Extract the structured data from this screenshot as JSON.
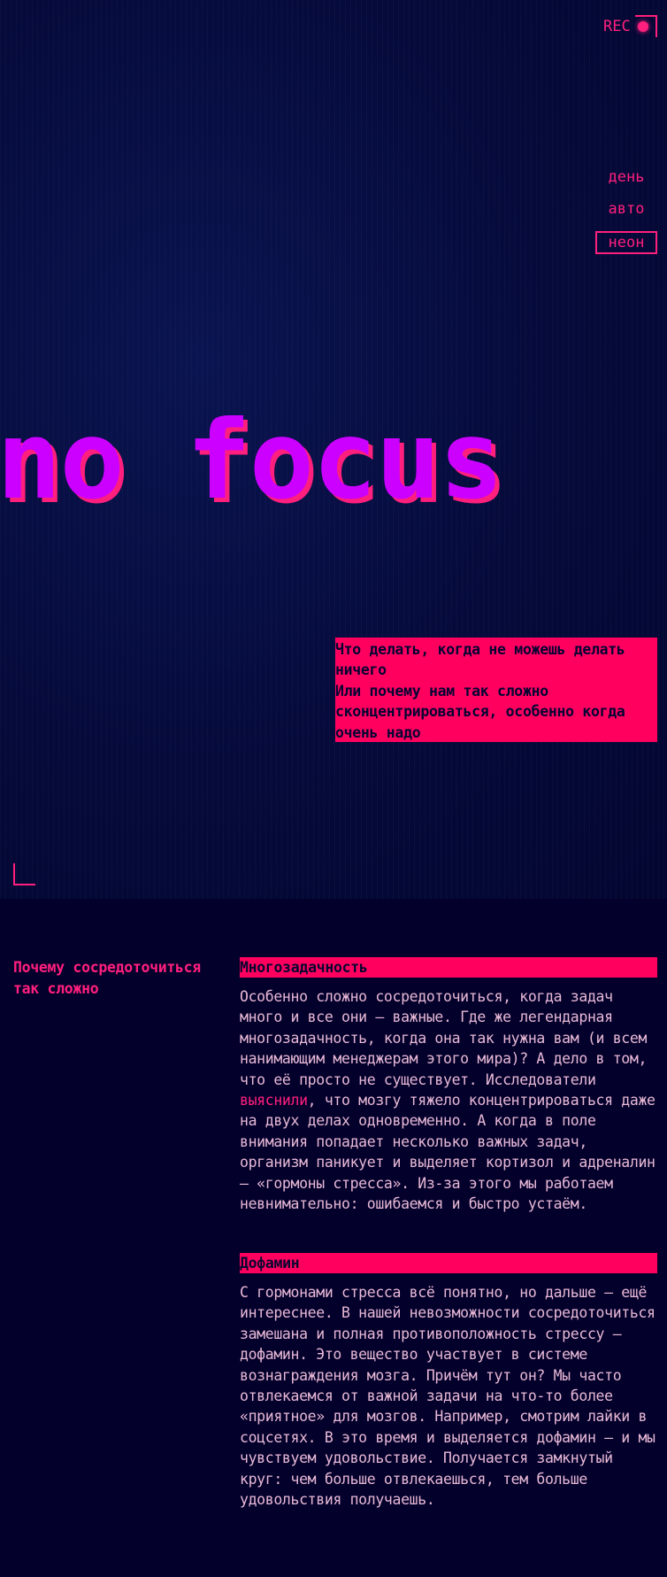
{
  "hero": {
    "rec_label": "REC",
    "title": "no focus",
    "subtitle_line1": "Что делать, когда не можешь делать ничего",
    "subtitle_line2": "Или почему нам так сложно сконцентрироваться, особенно когда очень надо"
  },
  "theme_switcher": {
    "items": [
      {
        "label": "день",
        "active": false
      },
      {
        "label": "авто",
        "active": false
      },
      {
        "label": "неон",
        "active": true
      }
    ]
  },
  "article": {
    "side_heading": "Почему сосредоточиться так сложно",
    "sections": [
      {
        "heading": "Многозадачность",
        "text_before_link": "Особенно сложно сосредоточиться, когда задач много и все они — важные. Где же легендарная многозадачность, когда она так нужна вам (и всем нанимающим менеджерам этого мира)? А дело в том, что её просто не существует. Исследователи ",
        "link": "выяснили",
        "text_after_link": ", что мозгу тяжело концентрироваться даже на двух делах одновременно. А когда в поле внимания попадает несколько важных задач, организм паникует и выделяет кортизол и адреналин — «гормоны стресса». Из-за этого мы работаем невнимательно: ошибаемся и быстро устаём."
      },
      {
        "heading": "Дофамин",
        "text": "С гормонами стресса всё понятно, но дальше — ещё интереснее. В нашей невозможности сосредоточиться замешана и полная противоположность стрессу — дофамин. Это вещество участвует в системе вознаграждения мозга. Причём тут он? Мы часто отвлекаемся от важной задачи на что-то более «приятное» для мозгов. Например, смотрим лайки в соцсетях. В это время и выделяется дофамин — и мы чувствуем удовольствие. Получается замкнутый круг: чем больше отвлекаешься, тем больше удовольствия получаешь."
      }
    ]
  },
  "colors": {
    "background": "#03002b",
    "accent_pink": "#ff005f",
    "title_purple": "#cc00ff",
    "body_text": "#e8b9d6"
  }
}
